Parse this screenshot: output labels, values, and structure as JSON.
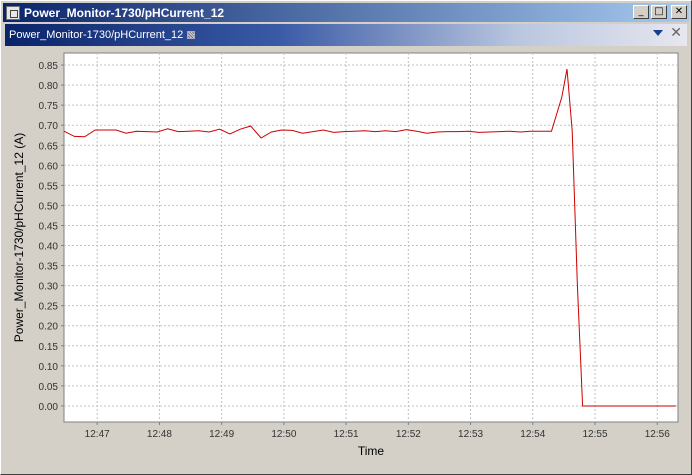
{
  "window": {
    "title": "Power_Monitor-1730/pHCurrent_12",
    "buttons": {
      "minimize": "_",
      "maximize": "□",
      "close": "✕"
    }
  },
  "inner_frame": {
    "title": "Power_Monitor-1730/pHCurrent_12",
    "menu_icon": "triangle-down-icon",
    "close_icon": "close-icon"
  },
  "colors": {
    "series": "#cc0000",
    "plot_background": "#ffffff",
    "grid": "#c0c0c0",
    "title_bar_start": "#0a246a",
    "title_bar_end": "#a6caf0"
  },
  "chart_data": {
    "type": "line",
    "title": "",
    "xlabel": "Time",
    "ylabel": "Power_Monitor-1730/pHCurrent_12 (A)",
    "ylim": [
      -0.04,
      0.88
    ],
    "xlim": [
      "12:46:28",
      "12:56:20"
    ],
    "grid": true,
    "x_ticks": [
      "12:47",
      "12:48",
      "12:49",
      "12:50",
      "12:51",
      "12:52",
      "12:53",
      "12:54",
      "12:55",
      "12:56"
    ],
    "y_ticks": [
      "0.00",
      "0.05",
      "0.10",
      "0.15",
      "0.20",
      "0.25",
      "0.30",
      "0.35",
      "0.40",
      "0.45",
      "0.50",
      "0.55",
      "0.60",
      "0.65",
      "0.70",
      "0.75",
      "0.80",
      "0.85"
    ],
    "series": [
      {
        "x": [
          "12:46:28",
          "12:46:38",
          "12:46:48",
          "12:46:58",
          "12:47:08",
          "12:47:18",
          "12:47:28",
          "12:47:38",
          "12:47:48",
          "12:47:58",
          "12:48:08",
          "12:48:18",
          "12:48:28",
          "12:48:38",
          "12:48:48",
          "12:48:58",
          "12:49:08",
          "12:49:18",
          "12:49:28",
          "12:49:38",
          "12:49:48",
          "12:49:58",
          "12:50:08",
          "12:50:18",
          "12:50:28",
          "12:50:38",
          "12:50:48",
          "12:50:58",
          "12:51:08",
          "12:51:18",
          "12:51:28",
          "12:51:38",
          "12:51:48",
          "12:51:58",
          "12:52:08",
          "12:52:18",
          "12:52:28",
          "12:52:38",
          "12:52:48",
          "12:52:58",
          "12:53:08",
          "12:53:18",
          "12:53:28",
          "12:53:38",
          "12:53:48",
          "12:53:58",
          "12:54:08",
          "12:54:18",
          "12:54:28",
          "12:54:33",
          "12:54:38",
          "12:54:43",
          "12:54:48",
          "12:54:58",
          "12:55:08",
          "12:55:28",
          "12:55:48",
          "12:56:08",
          "12:56:18"
        ],
        "y": [
          0.685,
          0.672,
          0.671,
          0.688,
          0.688,
          0.688,
          0.68,
          0.685,
          0.684,
          0.683,
          0.691,
          0.684,
          0.685,
          0.686,
          0.683,
          0.69,
          0.678,
          0.69,
          0.698,
          0.668,
          0.683,
          0.688,
          0.687,
          0.68,
          0.684,
          0.688,
          0.682,
          0.684,
          0.685,
          0.686,
          0.684,
          0.686,
          0.684,
          0.689,
          0.685,
          0.68,
          0.683,
          0.684,
          0.684,
          0.685,
          0.682,
          0.683,
          0.684,
          0.685,
          0.683,
          0.685,
          0.685,
          0.685,
          0.77,
          0.84,
          0.686,
          0.3,
          0.0,
          0.0,
          0.0,
          0.0,
          0.0,
          0.0,
          0.0
        ]
      }
    ]
  }
}
